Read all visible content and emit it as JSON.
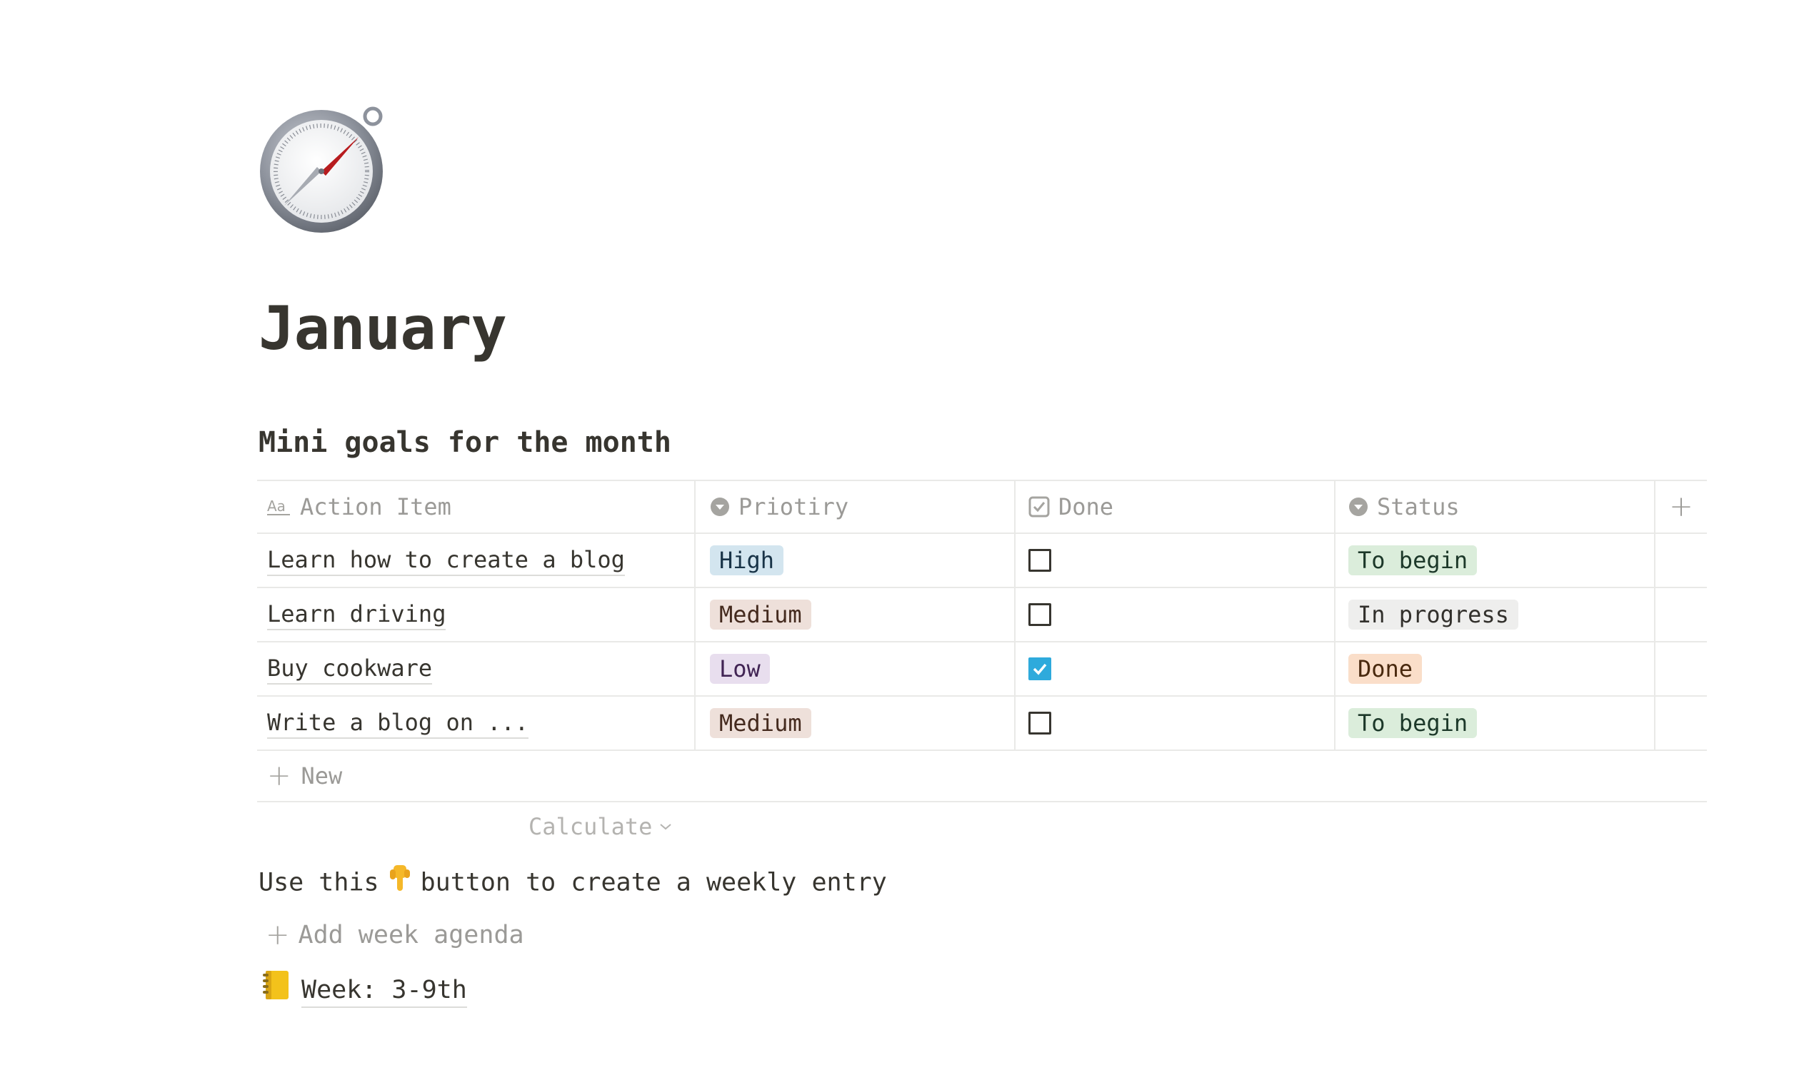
{
  "page": {
    "title": "January",
    "icon": "compass-icon"
  },
  "section": {
    "heading": "Mini goals for the month"
  },
  "table": {
    "columns": [
      {
        "label": "Action Item",
        "icon": "text-property-icon"
      },
      {
        "label": "Priotiry",
        "icon": "select-property-icon"
      },
      {
        "label": "Done",
        "icon": "checkbox-property-icon"
      },
      {
        "label": "Status",
        "icon": "select-property-icon"
      }
    ],
    "add_column_label": "+",
    "rows": [
      {
        "action": "Learn how to create a blog",
        "priority": "High",
        "done": false,
        "status": "To begin"
      },
      {
        "action": "Learn driving",
        "priority": "Medium",
        "done": false,
        "status": "In progress"
      },
      {
        "action": "Buy cookware",
        "priority": "Low",
        "done": true,
        "status": "Done"
      },
      {
        "action": "Write a blog on ...",
        "priority": "Medium",
        "done": false,
        "status": "To begin"
      }
    ],
    "new_label": "New",
    "calculate_label": "Calculate"
  },
  "colors": {
    "priority": {
      "High": "#d3e5ef",
      "Medium": "#eee0da",
      "Low": "#e8deee"
    },
    "status": {
      "To begin": "#dbeddb",
      "In progress": "#eeeeed",
      "Done": "#fadec9"
    },
    "checkbox_checked": "#2eaadc"
  },
  "hint": {
    "before": "Use this",
    "icon": "point-down-icon",
    "after": "button to create a weekly entry"
  },
  "add_button": {
    "label": "Add week agenda"
  },
  "week_link": {
    "icon": "notebook-icon",
    "label": "Week: 3-9th"
  }
}
